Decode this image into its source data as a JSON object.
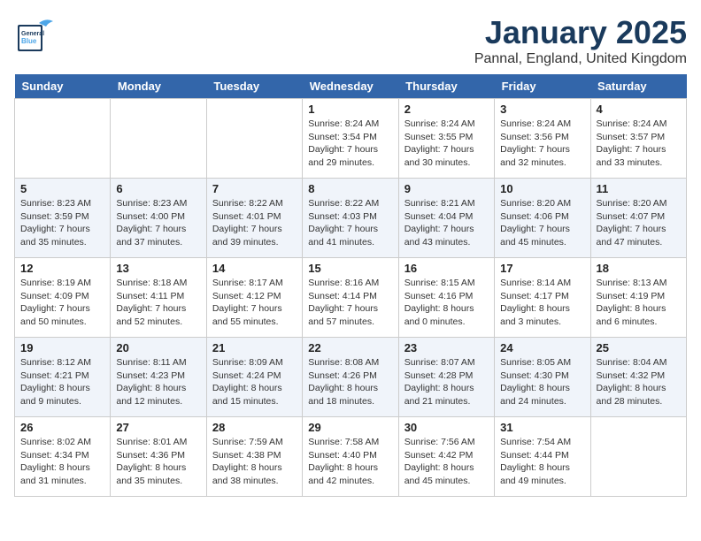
{
  "header": {
    "logo_general": "General",
    "logo_blue": "Blue",
    "month": "January 2025",
    "location": "Pannal, England, United Kingdom"
  },
  "weekdays": [
    "Sunday",
    "Monday",
    "Tuesday",
    "Wednesday",
    "Thursday",
    "Friday",
    "Saturday"
  ],
  "weeks": [
    [
      {
        "day": "",
        "text": ""
      },
      {
        "day": "",
        "text": ""
      },
      {
        "day": "",
        "text": ""
      },
      {
        "day": "1",
        "text": "Sunrise: 8:24 AM\nSunset: 3:54 PM\nDaylight: 7 hours and 29 minutes."
      },
      {
        "day": "2",
        "text": "Sunrise: 8:24 AM\nSunset: 3:55 PM\nDaylight: 7 hours and 30 minutes."
      },
      {
        "day": "3",
        "text": "Sunrise: 8:24 AM\nSunset: 3:56 PM\nDaylight: 7 hours and 32 minutes."
      },
      {
        "day": "4",
        "text": "Sunrise: 8:24 AM\nSunset: 3:57 PM\nDaylight: 7 hours and 33 minutes."
      }
    ],
    [
      {
        "day": "5",
        "text": "Sunrise: 8:23 AM\nSunset: 3:59 PM\nDaylight: 7 hours and 35 minutes."
      },
      {
        "day": "6",
        "text": "Sunrise: 8:23 AM\nSunset: 4:00 PM\nDaylight: 7 hours and 37 minutes."
      },
      {
        "day": "7",
        "text": "Sunrise: 8:22 AM\nSunset: 4:01 PM\nDaylight: 7 hours and 39 minutes."
      },
      {
        "day": "8",
        "text": "Sunrise: 8:22 AM\nSunset: 4:03 PM\nDaylight: 7 hours and 41 minutes."
      },
      {
        "day": "9",
        "text": "Sunrise: 8:21 AM\nSunset: 4:04 PM\nDaylight: 7 hours and 43 minutes."
      },
      {
        "day": "10",
        "text": "Sunrise: 8:20 AM\nSunset: 4:06 PM\nDaylight: 7 hours and 45 minutes."
      },
      {
        "day": "11",
        "text": "Sunrise: 8:20 AM\nSunset: 4:07 PM\nDaylight: 7 hours and 47 minutes."
      }
    ],
    [
      {
        "day": "12",
        "text": "Sunrise: 8:19 AM\nSunset: 4:09 PM\nDaylight: 7 hours and 50 minutes."
      },
      {
        "day": "13",
        "text": "Sunrise: 8:18 AM\nSunset: 4:11 PM\nDaylight: 7 hours and 52 minutes."
      },
      {
        "day": "14",
        "text": "Sunrise: 8:17 AM\nSunset: 4:12 PM\nDaylight: 7 hours and 55 minutes."
      },
      {
        "day": "15",
        "text": "Sunrise: 8:16 AM\nSunset: 4:14 PM\nDaylight: 7 hours and 57 minutes."
      },
      {
        "day": "16",
        "text": "Sunrise: 8:15 AM\nSunset: 4:16 PM\nDaylight: 8 hours and 0 minutes."
      },
      {
        "day": "17",
        "text": "Sunrise: 8:14 AM\nSunset: 4:17 PM\nDaylight: 8 hours and 3 minutes."
      },
      {
        "day": "18",
        "text": "Sunrise: 8:13 AM\nSunset: 4:19 PM\nDaylight: 8 hours and 6 minutes."
      }
    ],
    [
      {
        "day": "19",
        "text": "Sunrise: 8:12 AM\nSunset: 4:21 PM\nDaylight: 8 hours and 9 minutes."
      },
      {
        "day": "20",
        "text": "Sunrise: 8:11 AM\nSunset: 4:23 PM\nDaylight: 8 hours and 12 minutes."
      },
      {
        "day": "21",
        "text": "Sunrise: 8:09 AM\nSunset: 4:24 PM\nDaylight: 8 hours and 15 minutes."
      },
      {
        "day": "22",
        "text": "Sunrise: 8:08 AM\nSunset: 4:26 PM\nDaylight: 8 hours and 18 minutes."
      },
      {
        "day": "23",
        "text": "Sunrise: 8:07 AM\nSunset: 4:28 PM\nDaylight: 8 hours and 21 minutes."
      },
      {
        "day": "24",
        "text": "Sunrise: 8:05 AM\nSunset: 4:30 PM\nDaylight: 8 hours and 24 minutes."
      },
      {
        "day": "25",
        "text": "Sunrise: 8:04 AM\nSunset: 4:32 PM\nDaylight: 8 hours and 28 minutes."
      }
    ],
    [
      {
        "day": "26",
        "text": "Sunrise: 8:02 AM\nSunset: 4:34 PM\nDaylight: 8 hours and 31 minutes."
      },
      {
        "day": "27",
        "text": "Sunrise: 8:01 AM\nSunset: 4:36 PM\nDaylight: 8 hours and 35 minutes."
      },
      {
        "day": "28",
        "text": "Sunrise: 7:59 AM\nSunset: 4:38 PM\nDaylight: 8 hours and 38 minutes."
      },
      {
        "day": "29",
        "text": "Sunrise: 7:58 AM\nSunset: 4:40 PM\nDaylight: 8 hours and 42 minutes."
      },
      {
        "day": "30",
        "text": "Sunrise: 7:56 AM\nSunset: 4:42 PM\nDaylight: 8 hours and 45 minutes."
      },
      {
        "day": "31",
        "text": "Sunrise: 7:54 AM\nSunset: 4:44 PM\nDaylight: 8 hours and 49 minutes."
      },
      {
        "day": "",
        "text": ""
      }
    ]
  ]
}
